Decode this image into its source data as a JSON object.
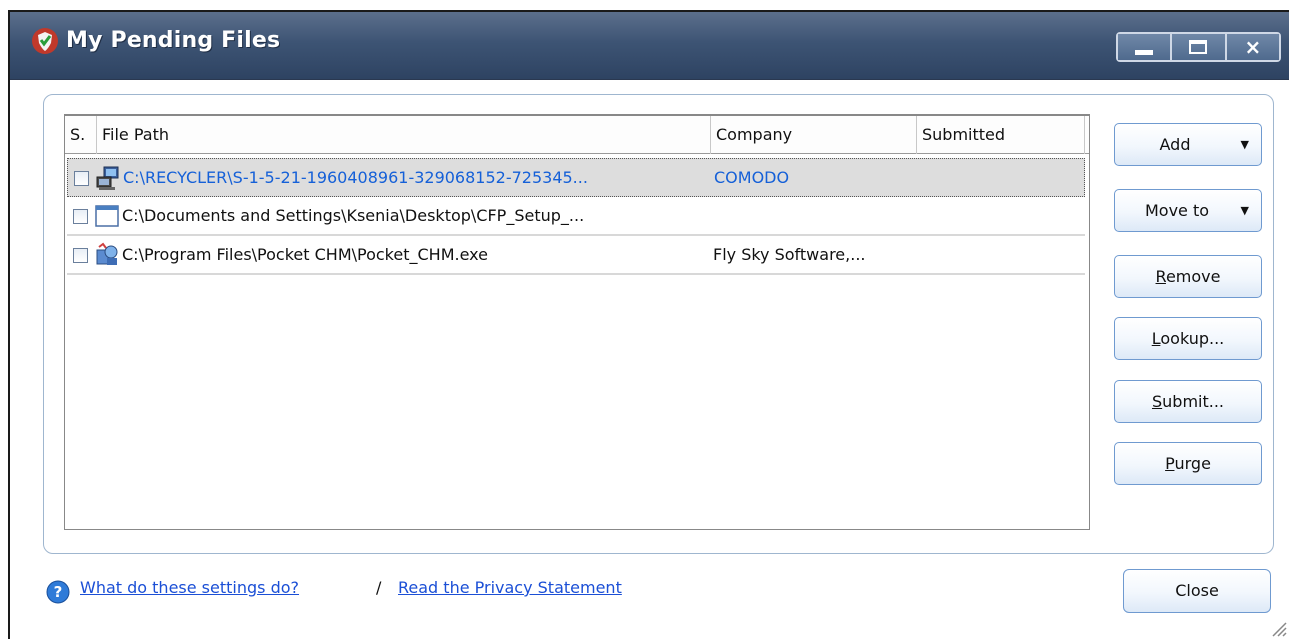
{
  "window": {
    "title": "My Pending Files",
    "controls": {
      "minimize": "minimize",
      "maximize": "maximize",
      "close": "×"
    }
  },
  "list": {
    "columns": [
      "S.",
      "File Path",
      "Company",
      "Submitted"
    ],
    "rows": [
      {
        "path": "C:\\RECYCLER\\S-1-5-21-1960408961-329068152-725345...",
        "company": "COMODO",
        "submitted": "",
        "selected": true,
        "icon": "computer-icon"
      },
      {
        "path": "C:\\Documents and Settings\\Ksenia\\Desktop\\CFP_Setup_...",
        "company": "",
        "submitted": "",
        "selected": false,
        "icon": "window-icon"
      },
      {
        "path": "C:\\Program Files\\Pocket CHM\\Pocket_CHM.exe",
        "company": "Fly Sky Software,...",
        "submitted": "",
        "selected": false,
        "icon": "setup-icon"
      }
    ]
  },
  "buttons": {
    "add": "Add",
    "move_to": "Move to",
    "remove_first": "R",
    "remove_rest": "emove",
    "lookup_first": "L",
    "lookup_rest": "ookup...",
    "submit_first": "S",
    "submit_rest": "ubmit...",
    "purge_first": "P",
    "purge_rest": "urge",
    "dropdown_arrow": "▼"
  },
  "footer": {
    "help_link": "What do these settings do?",
    "separator": "/",
    "privacy_link": "Read the Privacy Statement",
    "close": "Close"
  },
  "colors": {
    "title_bar": "#3d5474",
    "link": "#1b4fd6",
    "selected_text": "#1560d8"
  }
}
